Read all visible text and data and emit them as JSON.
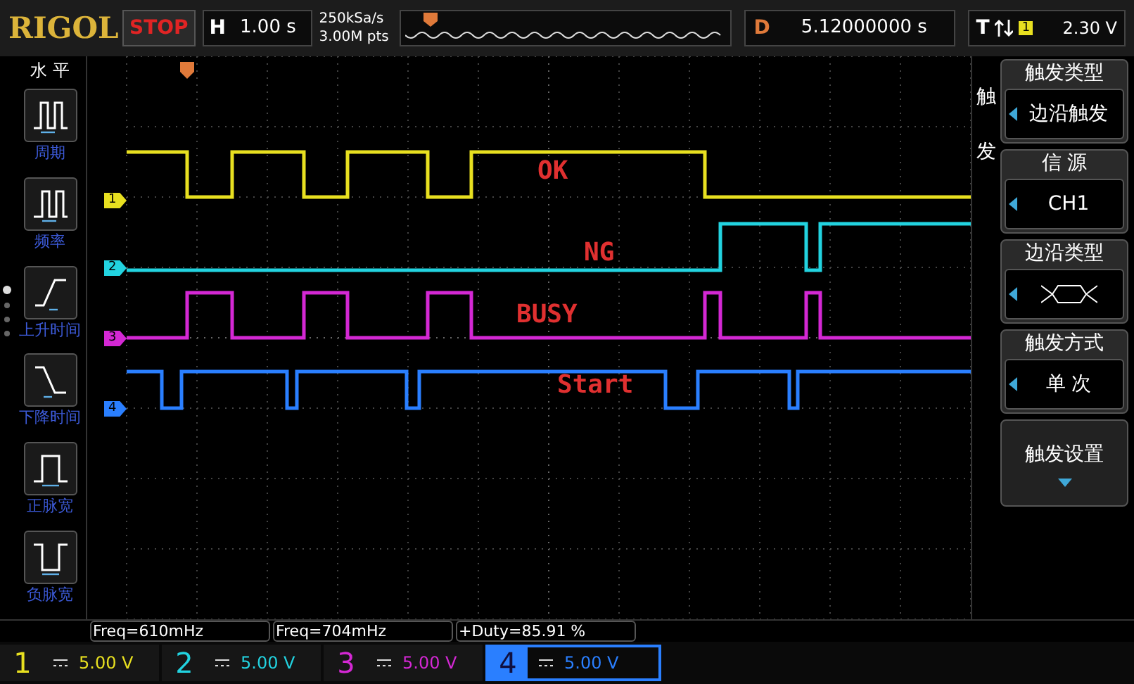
{
  "top_bar": {
    "logo": "RIGOL",
    "run_state": "STOP",
    "horizontal": {
      "label": "H",
      "value": "1.00 s"
    },
    "sample_rate": "250kSa/s",
    "memory_depth": "3.00M pts",
    "delay": {
      "label": "D",
      "value": "5.12000000 s"
    },
    "trigger": {
      "label": "T",
      "source": "1",
      "threshold": "2.30 V"
    }
  },
  "measure_menu": {
    "title": "水 平",
    "page_dots": [
      {
        "selected": true
      },
      {
        "selected": false
      },
      {
        "selected": false
      },
      {
        "selected": false
      }
    ],
    "items": [
      {
        "label": "周期"
      },
      {
        "label": "频率"
      },
      {
        "label": "上升时间"
      },
      {
        "label": "下降时间"
      },
      {
        "label": "正脉宽"
      },
      {
        "label": "负脉宽"
      }
    ]
  },
  "trigger_menu": {
    "title": "触发",
    "items": [
      {
        "kind": "select",
        "header": "触发类型",
        "value": "边沿触发"
      },
      {
        "kind": "select",
        "header": "信 源",
        "value": "CH1"
      },
      {
        "kind": "edge",
        "header": "边沿类型"
      },
      {
        "kind": "select",
        "header": "触发方式",
        "value": "单 次"
      },
      {
        "kind": "submenu",
        "header": "触发设置"
      }
    ]
  },
  "channels": [
    {
      "number": "1",
      "marker": "1",
      "label": "OK",
      "color": "#e8e020",
      "scale": "5.00 V",
      "selected": false
    },
    {
      "number": "2",
      "marker": "2",
      "label": "NG",
      "color": "#22d3e0",
      "scale": "5.00 V",
      "selected": false
    },
    {
      "number": "3",
      "marker": "3",
      "label": "BUSY",
      "color": "#d428d4",
      "scale": "5.00 V",
      "selected": false
    },
    {
      "number": "4",
      "marker": "4",
      "label": "Start",
      "color": "#2a7fff",
      "scale": "5.00 V",
      "selected": true
    }
  ],
  "measurements": [
    "Freq=610mHz",
    "Freq=704mHz",
    "+Duty=85.91 %"
  ]
}
